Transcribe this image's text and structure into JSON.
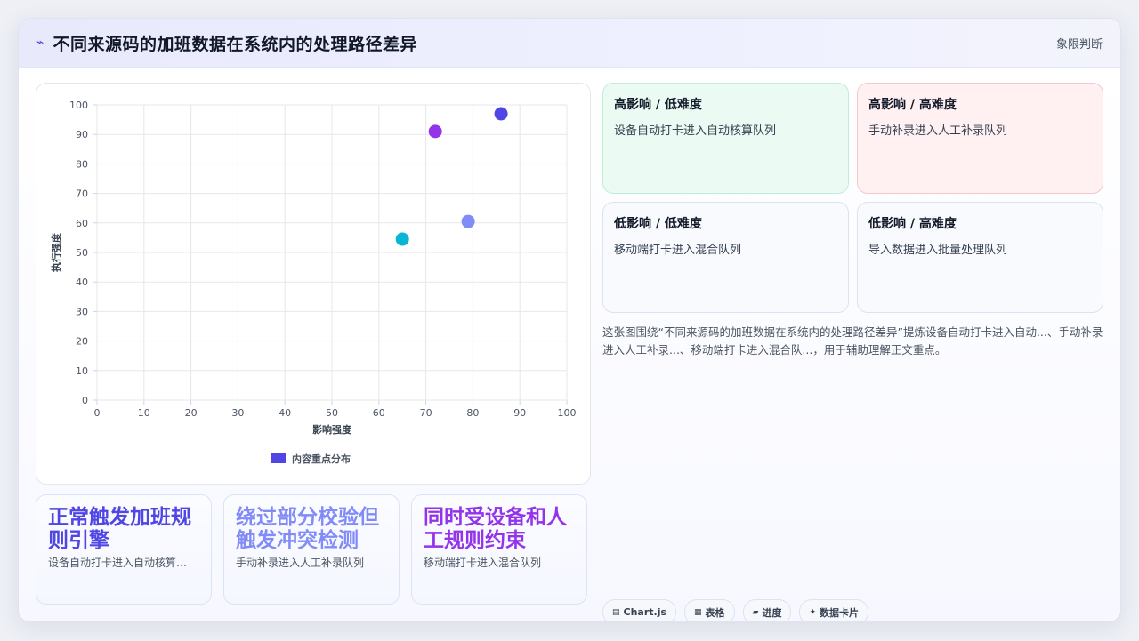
{
  "header": {
    "icon": "bolt-icon",
    "title": "不同来源码的加班数据在系统内的处理路径差异",
    "tag": "象限判断"
  },
  "chart_data": {
    "type": "scatter",
    "xlabel": "影响强度",
    "ylabel": "执行强度",
    "xlim": [
      0,
      100
    ],
    "ylim": [
      0,
      100
    ],
    "xticks": [
      "0",
      "10",
      "20",
      "30",
      "40",
      "50",
      "60",
      "70",
      "80",
      "90",
      "100"
    ],
    "yticks": [
      "0",
      "10",
      "20",
      "30",
      "40",
      "50",
      "60",
      "70",
      "80",
      "90",
      "100"
    ],
    "grid": true,
    "legend_position": "bottom",
    "series": [
      {
        "name": "内容重点分布",
        "points": [
          {
            "x": 86,
            "y": 97,
            "color": "#4f46e5"
          },
          {
            "x": 72,
            "y": 91,
            "color": "#9333ea"
          },
          {
            "x": 79,
            "y": 60.5,
            "color": "#818cf8"
          },
          {
            "x": 65,
            "y": 54.5,
            "color": "#06b6d4"
          }
        ]
      }
    ],
    "legend_color": "#4f46e5"
  },
  "stats": [
    {
      "title": "正常触发加班规则引擎",
      "sub": "设备自动打卡进入自动核算队列",
      "color": "#4f46e5"
    },
    {
      "title": "绕过部分校验但触发冲突检测",
      "sub": "手动补录进入人工补录队列",
      "color": "#818cf8"
    },
    {
      "title": "同时受设备和人工规则约束",
      "sub": "移动端打卡进入混合队列",
      "color": "#9333ea"
    }
  ],
  "quadrants": [
    {
      "title": "高影响 / 低难度",
      "desc": "设备自动打卡进入自动核算队列",
      "tone": "green"
    },
    {
      "title": "高影响 / 高难度",
      "desc": "手动补录进入人工补录队列",
      "tone": "red"
    },
    {
      "title": "低影响 / 低难度",
      "desc": "移动端打卡进入混合队列",
      "tone": "plain"
    },
    {
      "title": "低影响 / 高难度",
      "desc": "导入数据进入批量处理队列",
      "tone": "plain"
    }
  ],
  "summary": "这张图围绕“不同来源码的加班数据在系统内的处理路径差异”提炼设备自动打卡进入自动...、手动补录进入人工补录...、移动端打卡进入混合队...，用于辅助理解正文重点。",
  "chips": [
    {
      "icon": "chart-icon",
      "glyph": "▤",
      "label": "Chart.js"
    },
    {
      "icon": "table-icon",
      "glyph": "▦",
      "label": "表格"
    },
    {
      "icon": "folder-icon",
      "glyph": "▰",
      "label": "进度"
    },
    {
      "icon": "sparkle-icon",
      "glyph": "✦",
      "label": "数据卡片"
    }
  ]
}
